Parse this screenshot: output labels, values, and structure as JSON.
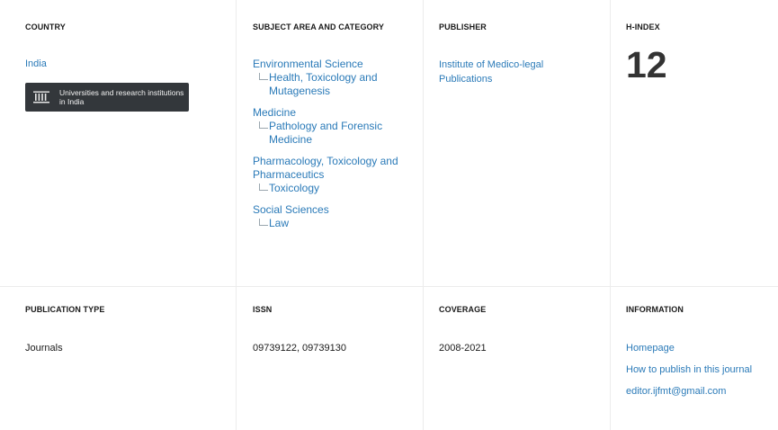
{
  "top": {
    "country": {
      "heading": "COUNTRY",
      "link": "India",
      "badge": {
        "icon": "institution-columns-icon",
        "text": "Universities and research institutions in India"
      }
    },
    "subject_area": {
      "heading": "SUBJECT AREA AND CATEGORY",
      "areas": [
        {
          "area": "Environmental Science",
          "categories": [
            "Health, Toxicology and Mutagenesis"
          ]
        },
        {
          "area": "Medicine",
          "categories": [
            "Pathology and Forensic Medicine"
          ]
        },
        {
          "area": "Pharmacology, Toxicology and Pharmaceutics",
          "categories": [
            "Toxicology"
          ]
        },
        {
          "area": "Social Sciences",
          "categories": [
            "Law"
          ]
        }
      ]
    },
    "publisher": {
      "heading": "PUBLISHER",
      "name": "Institute of Medico-legal Publications"
    },
    "hindex": {
      "heading": "H-INDEX",
      "value": "12"
    }
  },
  "bottom": {
    "publication_type": {
      "heading": "PUBLICATION TYPE",
      "value": "Journals"
    },
    "issn": {
      "heading": "ISSN",
      "value": "09739122, 09739130"
    },
    "coverage": {
      "heading": "COVERAGE",
      "value": "2008-2021"
    },
    "information": {
      "heading": "INFORMATION",
      "links": [
        "Homepage",
        "How to publish in this journal",
        "editor.ijfmt@gmail.com"
      ]
    }
  },
  "colors": {
    "link": "#2a7ab8",
    "badge_bg": "#33373b",
    "divider": "#ececec"
  }
}
